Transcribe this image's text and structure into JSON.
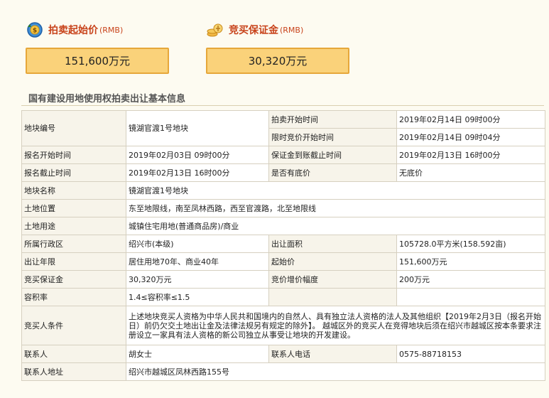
{
  "start_price": {
    "title": "拍卖起始价",
    "unit": "(RMB)",
    "value": "151,600万元"
  },
  "deposit": {
    "title": "竞买保证金",
    "unit": "(RMB)",
    "value": "30,320万元"
  },
  "section_title": "国有建设用地使用权拍卖出让基本信息",
  "fields": {
    "plot_no_label": "地块编号",
    "plot_no": "镜湖官渡1号地块",
    "auction_start_label": "拍卖开始时间",
    "auction_start": "2019年02月14日 09时00分",
    "timed_bid_label": "限时竞价开始时间",
    "timed_bid": "2019年02月14日 09时04分",
    "reg_start_label": "报名开始时间",
    "reg_start": "2019年02月03日 09时00分",
    "deposit_deadline_label": "保证金到账截止时间",
    "deposit_deadline": "2019年02月13日 16时00分",
    "reg_end_label": "报名截止时间",
    "reg_end": "2019年02月13日 16时00分",
    "reserve_label": "是否有底价",
    "reserve": "无底价",
    "plot_name_label": "地块名称",
    "plot_name": "镜湖官渡1号地块",
    "location_label": "土地位置",
    "location": "东至地限线，南至凤林西路，西至官渡路，北至地限线",
    "usage_label": "土地用途",
    "usage": "城镇住宅用地(普通商品房)/商业",
    "district_label": "所属行政区",
    "district": "绍兴市(本级)",
    "area_label": "出让面积",
    "area": "105728.0平方米(158.592亩)",
    "term_label": "出让年限",
    "term": "居住用地70年、商业40年",
    "start_price_label": "起始价",
    "start_price": "151,600万元",
    "deposit_label": "竞买保证金",
    "deposit": "30,320万元",
    "increment_label": "竞价增价幅度",
    "increment": "200万元",
    "far_label": "容积率",
    "far": "1.4≤容积率≤1.5",
    "bidder_label": "竞买人条件",
    "bidder": "上述地块竞买人资格为中华人民共和国境内的自然人、具有独立法人资格的法人及其他组织【2019年2月3日（报名开始日）前仍欠交土地出让金及法律法规另有规定的除外】。 越城区外的竞买人在竞得地块后须在绍兴市越城区按本条要求注册设立一家具有法人资格的新公司独立从事受让地块的开发建设。",
    "contact_label": "联系人",
    "contact": "胡女士",
    "phone_label": "联系人电话",
    "phone": "0575-88718153",
    "address_label": "联系人地址",
    "address": "绍兴市越城区凤林西路155号"
  }
}
